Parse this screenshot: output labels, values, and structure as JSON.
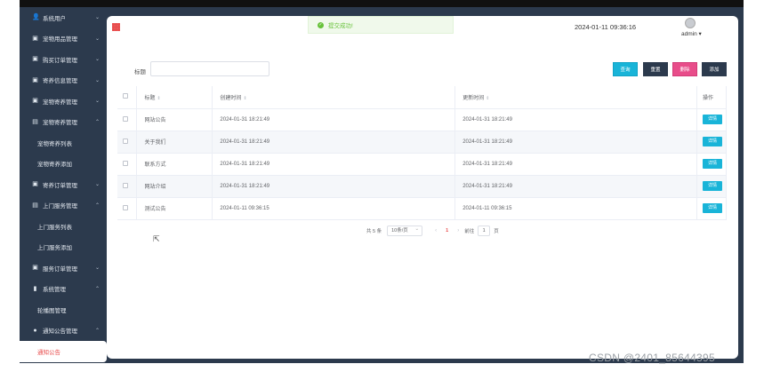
{
  "sidebar": {
    "items": [
      {
        "label": "系统用户",
        "icon": "user-icon",
        "type": "menu",
        "expanded": false
      },
      {
        "label": "宠物用品管理",
        "icon": "box-icon",
        "type": "menu",
        "expanded": false
      },
      {
        "label": "购买订单管理",
        "icon": "box-icon",
        "type": "menu",
        "expanded": false
      },
      {
        "label": "寄养信息管理",
        "icon": "box-icon",
        "type": "menu",
        "expanded": false
      },
      {
        "label": "宠物寄养管理",
        "icon": "box-icon",
        "type": "menu",
        "expanded": false
      },
      {
        "label": "宠物寄养管理",
        "icon": "doc-icon",
        "type": "menu",
        "expanded": true
      },
      {
        "label": "宠物寄养列表",
        "type": "sub"
      },
      {
        "label": "宠物寄养添加",
        "type": "sub"
      },
      {
        "label": "寄养订单管理",
        "icon": "box-icon",
        "type": "menu",
        "expanded": false
      },
      {
        "label": "上门服务管理",
        "icon": "doc-icon",
        "type": "menu",
        "expanded": true
      },
      {
        "label": "上门服务列表",
        "type": "sub"
      },
      {
        "label": "上门服务添加",
        "type": "sub"
      },
      {
        "label": "服务订单管理",
        "icon": "box-icon",
        "type": "menu",
        "expanded": false
      },
      {
        "label": "系统管理",
        "icon": "chart-icon",
        "type": "menu",
        "expanded": true
      },
      {
        "label": "轮播图管理",
        "type": "sub"
      },
      {
        "label": "通知公告管理",
        "icon": "info-icon",
        "type": "menu",
        "expanded": true
      },
      {
        "label": "通知公告",
        "type": "sub",
        "active": true
      }
    ]
  },
  "header": {
    "toast": "提交成功!",
    "datetime": "2024-01-11 09:36:16",
    "user": "admin ▾"
  },
  "search": {
    "label": "标题",
    "value": "",
    "placeholder": ""
  },
  "buttons": {
    "query": "查询",
    "reset": "重置",
    "delete": "删除",
    "add": "添加"
  },
  "table": {
    "headers": {
      "title": "标题",
      "created": "创建时间",
      "updated": "更新时间",
      "ops": "操作"
    },
    "rows": [
      {
        "title": "网站公告",
        "created": "2024-01-31 18:21:49",
        "updated": "2024-01-31 18:21:49",
        "action": "详情"
      },
      {
        "title": "关于我们",
        "created": "2024-01-31 18:21:49",
        "updated": "2024-01-31 18:21:49",
        "action": "详情"
      },
      {
        "title": "联系方式",
        "created": "2024-01-31 18:21:49",
        "updated": "2024-01-31 18:21:49",
        "action": "详情"
      },
      {
        "title": "网站介绍",
        "created": "2024-01-31 18:21:49",
        "updated": "2024-01-31 18:21:49",
        "action": "详情"
      },
      {
        "title": "测试公告",
        "created": "2024-01-11 09:36:15",
        "updated": "2024-01-11 09:36:15",
        "action": "详情"
      }
    ]
  },
  "pagination": {
    "total": "共 5 条",
    "page_size": "10条/页",
    "current": "1",
    "goto_label": "前往",
    "goto_value": "1",
    "page_suffix": "页"
  },
  "watermark": "CSDN @2401_85644395",
  "colors": {
    "sidebar_bg": "#2c3a4d",
    "accent": "#19b4d8",
    "danger": "#e84d8a",
    "active_text": "#e84d4d"
  }
}
